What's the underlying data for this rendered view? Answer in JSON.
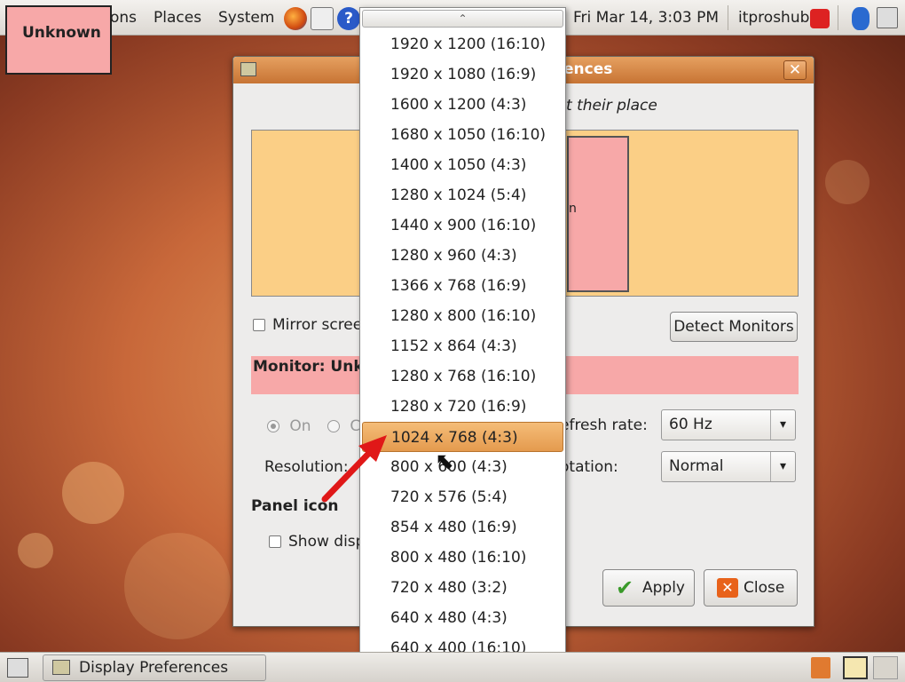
{
  "top_panel": {
    "menus": [
      "ons",
      "Places",
      "System"
    ],
    "clock": "Fri Mar 14,  3:03 PM",
    "user": "itproshub"
  },
  "unknown_label": "Unknown",
  "dialog": {
    "title": "ences",
    "close_glyph": "✕",
    "instruction": "t their place",
    "monitor_rect_label": "n",
    "mirror_label": "Mirror scree",
    "detect_button": "Detect Monitors",
    "monitor_bar_label": "Monitor: Unk",
    "on_label": "On",
    "off_label": "C",
    "refresh_label": "efresh rate:",
    "refresh_value": "60 Hz",
    "rotation_label": "otation:",
    "rotation_value": "Normal",
    "resolution_label": "Resolution:",
    "panel_icon_heading": "Panel icon",
    "show_label": "Show disp",
    "apply_button": "Apply",
    "close_button": "Close"
  },
  "dropdown": {
    "selected_index": 13,
    "items": [
      "1920 x 1200 (16:10)",
      "1920 x 1080 (16:9)",
      "1600 x 1200 (4:3)",
      "1680 x 1050 (16:10)",
      "1400 x 1050 (4:3)",
      "1280 x 1024 (5:4)",
      "1440 x 900 (16:10)",
      "1280 x 960 (4:3)",
      "1366 x 768 (16:9)",
      "1280 x 800 (16:10)",
      "1152 x 864 (4:3)",
      "1280 x 768 (16:10)",
      "1280 x 720 (16:9)",
      "1024 x 768 (4:3)",
      "800 x 600 (4:3)",
      "720 x 576 (5:4)",
      "854 x 480 (16:9)",
      "800 x 480 (16:10)",
      "720 x 480 (3:2)",
      "640 x 480 (4:3)",
      "640 x 400 (16:10)"
    ]
  },
  "bottom_panel": {
    "task_label": "Display Preferences"
  }
}
